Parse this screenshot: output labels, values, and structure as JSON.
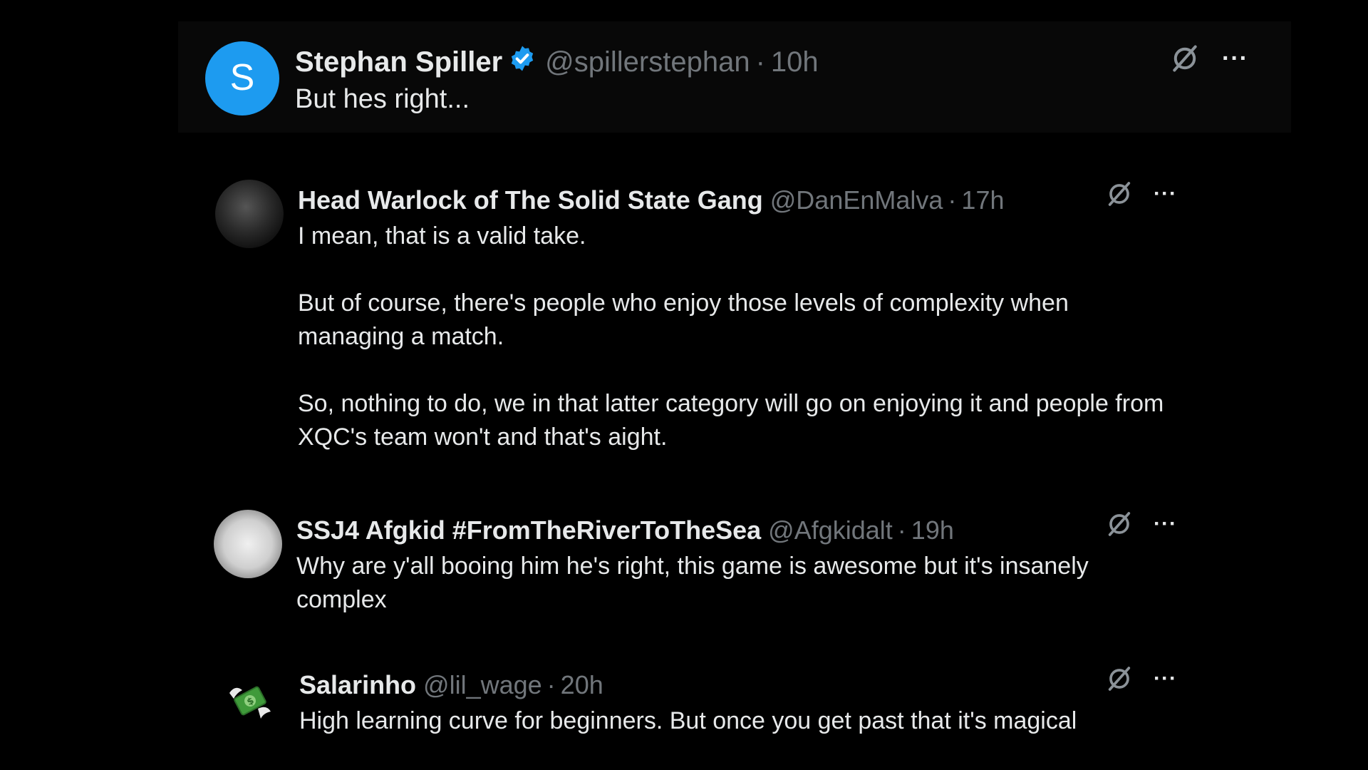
{
  "posts": [
    {
      "avatar_letter": "S",
      "name": "Stephan Spiller",
      "handle": "@spillerstephan",
      "separator": "·",
      "time": "10h",
      "verified": true,
      "paragraphs": [
        "But hes right..."
      ],
      "more": "···"
    },
    {
      "name": "Head Warlock of The Solid State Gang",
      "handle": "@DanEnMalva",
      "separator": "·",
      "time": "17h",
      "paragraphs": [
        "I mean, that is a valid take.",
        "But of course, there's people who enjoy those levels of complexity when managing a match.",
        "So, nothing to do, we in that latter category will go on enjoying it and people from XQC's team won't and that's aight."
      ],
      "more": "···"
    },
    {
      "name": "SSJ4 Afgkid #FromTheRiverToTheSea",
      "handle": "@Afgkidalt",
      "separator": "·",
      "time": "19h",
      "paragraphs": [
        "Why are y'all booing him he's right, this game is awesome but it's insanely complex"
      ],
      "more": "···"
    },
    {
      "name": "Salarinho",
      "handle": "@lil_wage",
      "separator": "·",
      "time": "20h",
      "paragraphs": [
        "High learning curve for beginners. But once you get past that it's magical"
      ],
      "more": "···"
    }
  ],
  "colors": {
    "background": "#000000",
    "text": "#e7e9ea",
    "muted": "#71767b",
    "verified": "#1d9bf0"
  },
  "icons": {
    "grok": "grok-icon",
    "more": "more-icon",
    "verified": "verified-badge-icon"
  }
}
